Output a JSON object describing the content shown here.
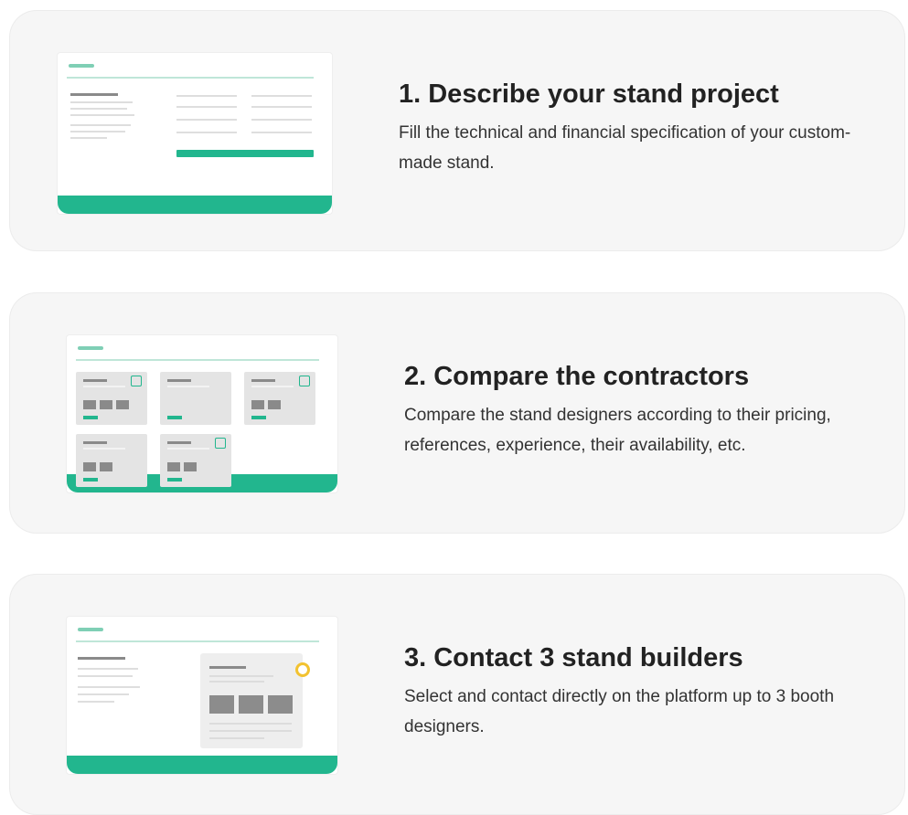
{
  "steps": [
    {
      "title": "1. Describe your stand project",
      "description": "Fill the technical and financial specification of your custom-made stand."
    },
    {
      "title": "2. Compare the contractors",
      "description": "Compare the stand designers according to their pricing, references, experience, their availability, etc."
    },
    {
      "title": "3. Contact 3 stand builders",
      "description": "Select and contact directly on the platform up to 3 booth designers."
    }
  ],
  "colors": {
    "accent": "#22b68e",
    "card_background": "#f6f6f6",
    "highlight_badge": "#f2c230"
  }
}
